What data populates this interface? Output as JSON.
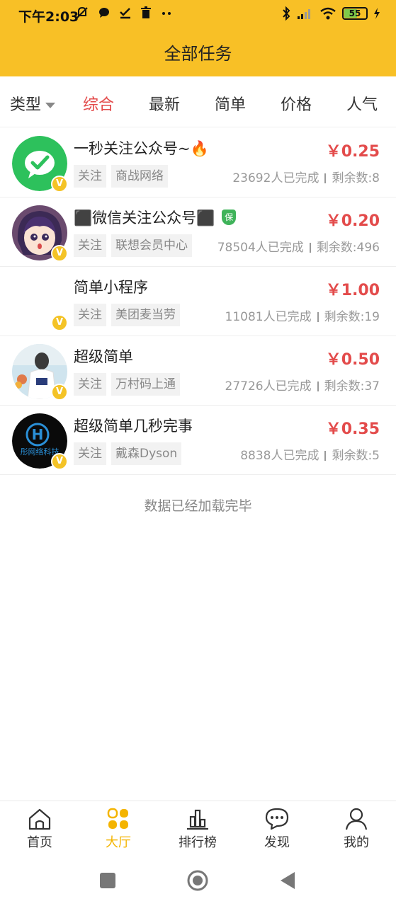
{
  "status_bar": {
    "time": "下午2:03",
    "battery": "55"
  },
  "header": {
    "title": "全部任务"
  },
  "filters": {
    "type_label": "类型",
    "tabs": [
      "综合",
      "最新",
      "简单",
      "价格",
      "人气"
    ],
    "active_tab": "综合"
  },
  "tasks": [
    {
      "title": "一秒关注公众号~🔥",
      "price": "￥0.25",
      "tag1": "关注",
      "tag2": "商战网络",
      "completed": "23692人已完成",
      "remaining": "剩余数:8",
      "avatar": "wechat-logo"
    },
    {
      "title": "⬛微信关注公众号⬛",
      "price": "￥0.20",
      "tag1": "关注",
      "tag2": "联想会员中心",
      "completed": "78504人已完成",
      "remaining": "剩余数:496",
      "avatar": "anime-girl",
      "badge": "保"
    },
    {
      "title": "简单小程序",
      "price": "￥1.00",
      "tag1": "关注",
      "tag2": "美团麦当劳",
      "completed": "11081人已完成",
      "remaining": "剩余数:19",
      "avatar": "blank"
    },
    {
      "title": "超级简单",
      "price": "￥0.50",
      "tag1": "关注",
      "tag2": "万村码上通",
      "completed": "27726人已完成",
      "remaining": "剩余数:37",
      "avatar": "person-photo"
    },
    {
      "title": "超级简单几秒完事",
      "price": "￥0.35",
      "tag1": "关注",
      "tag2": "戴森Dyson",
      "completed": "8838人已完成",
      "remaining": "剩余数:5",
      "avatar": "h-logo",
      "avatar_text": "彤网络科技"
    }
  ],
  "list_end_text": "数据已经加载完毕",
  "bottom_nav": [
    {
      "label": "首页",
      "icon": "home-icon"
    },
    {
      "label": "大厅",
      "icon": "hall-icon",
      "active": true
    },
    {
      "label": "排行榜",
      "icon": "ranking-icon"
    },
    {
      "label": "发现",
      "icon": "discover-icon"
    },
    {
      "label": "我的",
      "icon": "profile-icon"
    }
  ],
  "colors": {
    "header": "#f8c026",
    "price": "#e34b4b",
    "active_tab": "#e34b4b",
    "nav_active": "#f4b400",
    "v_badge": "#f4c326"
  }
}
